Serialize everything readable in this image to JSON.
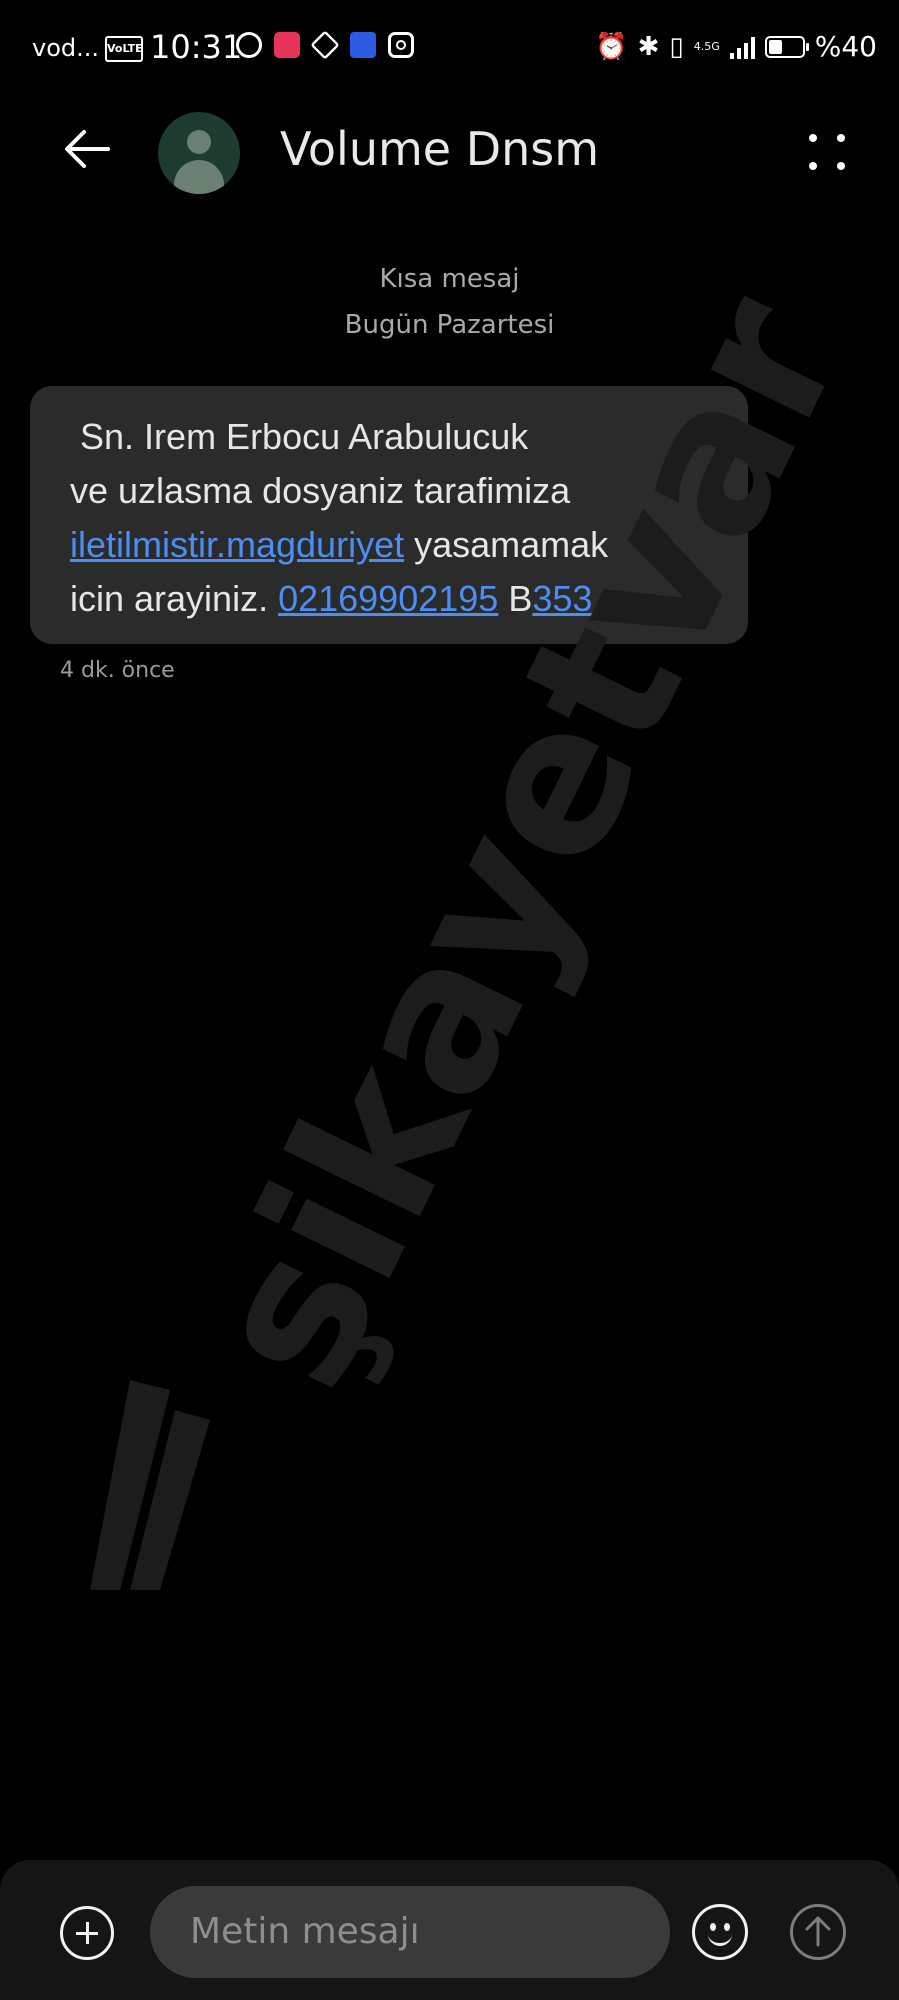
{
  "status_bar": {
    "carrier": "vod...",
    "volte": "VoLTE",
    "time": "10:31",
    "network": "4.5G",
    "battery_text": "%40",
    "battery_level_percent": 40,
    "icons": [
      "whatsapp-icon",
      "shopping-bag-icon",
      "heart-app-icon",
      "flag-app-icon",
      "instagram-icon",
      "alarm-icon",
      "bluetooth-icon",
      "vibrate-icon",
      "signal-icon",
      "battery-icon"
    ]
  },
  "header": {
    "contact_name": "Volume Dnsm"
  },
  "conversation": {
    "channel": "Kısa mesaj",
    "date": "Bugün Pazartesi",
    "message": {
      "part1": " Sn. Irem Erbocu Arabulucuk\nve uzlasma dosyaniz tarafimiza\n",
      "link_text": "iletilmistir.magduriyet",
      "part2": " yasamamak\nicin arayiniz. ",
      "phone": "02169902195",
      "part3": " B",
      "code": "353"
    },
    "timestamp": "4 dk. önce"
  },
  "watermark": {
    "text": "şikayetvar"
  },
  "composer": {
    "placeholder": "Metin mesajı"
  },
  "colors": {
    "background": "#000000",
    "bubble": "#2b2b2b",
    "link": "#4d8ef5",
    "input": "#3a3a3a"
  }
}
